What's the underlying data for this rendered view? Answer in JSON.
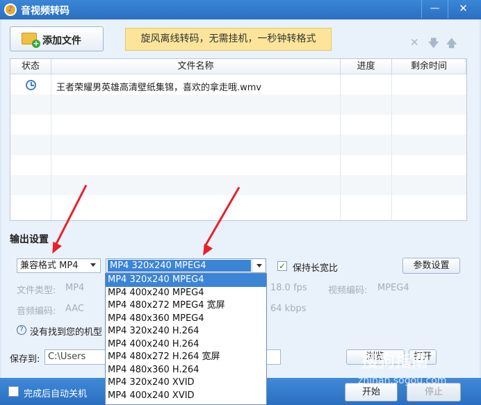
{
  "window": {
    "title": "音视频转码",
    "min_glyph": "—",
    "close_glyph": "✕"
  },
  "toolbar": {
    "add_file_label": "添加文件",
    "promo_text": "旋风离线转码，无需挂机，一秒钟转格式",
    "icons": [
      "close-icon",
      "arrow-down-icon",
      "arrow-up-icon"
    ],
    "delete_glyph": "✕",
    "down_glyph": "🡇",
    "up_glyph": "🡅"
  },
  "file_list": {
    "columns": [
      "状态",
      "文件名称",
      "进度",
      "剩余时间"
    ],
    "rows": [
      {
        "status": "clock-icon",
        "name": "王者荣耀男英雄高清壁纸集锦，喜欢的拿走哦.wmv",
        "progress": "",
        "remaining": ""
      }
    ]
  },
  "output": {
    "title": "输出设置",
    "format": "兼容格式 MP4",
    "preset": "MP4 320x240 MPEG4",
    "keep_ratio_label": "保持长宽比",
    "keep_ratio_checked": true,
    "check_glyph": "✓",
    "param_button": "参数设置",
    "file_type_label": "文件类型:",
    "file_type": "MP4",
    "audio_codec_label": "音频编码:",
    "audio_codec": "AAC",
    "fps": "18.0 fps",
    "video_codec_label": "视频编码:",
    "video_codec": "MPEG4",
    "bitrate": "64 kbps",
    "help_glyph": "?",
    "help_text": "没有找到您的机型"
  },
  "preset_options": [
    "MP4 320x240 MPEG4",
    "MP4 400x240 MPEG4",
    "MP4 480x272 MPEG4 宽屏",
    "MP4 480x360 MPEG4",
    "MP4 320x240 H.264",
    "MP4 400x240 H.264",
    "MP4 480x272 H.264 宽屏",
    "MP4 480x360 H.264",
    "MP4 320x240 XVID",
    "MP4 400x240 XVID"
  ],
  "save": {
    "label": "保存到:",
    "path": "C:\\Users",
    "browse": "浏览",
    "open": "打开"
  },
  "bottom": {
    "auto_shutdown": "完成后自动关机",
    "start": "开始",
    "stop": "停止"
  },
  "watermark": {
    "text": "搜狗指南",
    "url": "zhinan.sogou.com"
  },
  "colors": {
    "accent": "#2a6fc2",
    "arrow": "#e8202a",
    "selection": "#3b84d6"
  }
}
